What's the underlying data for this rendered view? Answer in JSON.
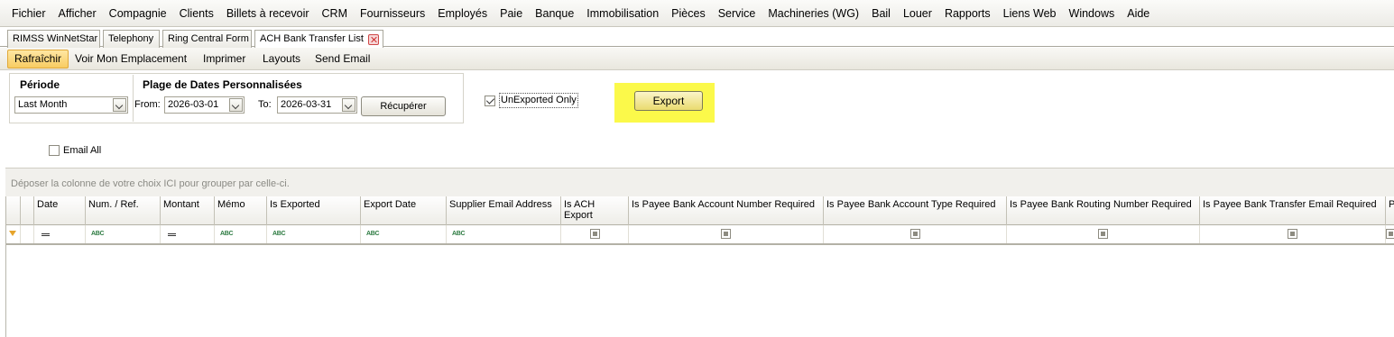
{
  "menu": [
    "Fichier",
    "Afficher",
    "Compagnie",
    "Clients",
    "Billets à recevoir",
    "CRM",
    "Fournisseurs",
    "Employés",
    "Paie",
    "Banque",
    "Immobilisation",
    "Pièces",
    "Service",
    "Machineries (WG)",
    "Bail",
    "Louer",
    "Rapports",
    "Liens Web",
    "Windows",
    "Aide"
  ],
  "tabs": [
    "RIMSS WinNetStar",
    "Telephony",
    "Ring Central Form",
    "ACH Bank Transfer List"
  ],
  "toolbar": {
    "refresh": "Rafraîchir",
    "view_location": "Voir Mon Emplacement",
    "print": "Imprimer",
    "layouts": "Layouts",
    "send_email": "Send Email"
  },
  "filters": {
    "period_title": "Période",
    "period_value": "Last Month",
    "range_title": "Plage de Dates Personnalisées",
    "from_label": "From:",
    "from_value": "2026-03-01",
    "to_label": "To:",
    "to_value": "2026-03-31",
    "retrieve_label": "Récupérer",
    "unexported_label": "UnExported Only",
    "unexported_checked": true,
    "export_label": "Export",
    "email_all_label": "Email All",
    "email_all_checked": false
  },
  "grid": {
    "group_hint": "Déposer la colonne de votre choix ICI pour grouper par celle-ci.",
    "columns": [
      {
        "label": "Date",
        "filter": "eq"
      },
      {
        "label": "Num. / Ref.",
        "filter": "abc"
      },
      {
        "label": "Montant",
        "filter": "eq"
      },
      {
        "label": "Mémo",
        "filter": "abc"
      },
      {
        "label": "Is Exported",
        "filter": "abc"
      },
      {
        "label": "Export Date",
        "filter": "abc"
      },
      {
        "label": "Supplier Email Address",
        "filter": "abc"
      },
      {
        "label": "Is ACH Export",
        "filter": "chk"
      },
      {
        "label": "Is Payee Bank Account Number Required",
        "filter": "chk"
      },
      {
        "label": "Is Payee Bank Account Type Required",
        "filter": "chk"
      },
      {
        "label": "Is Payee Bank Routing Number Required",
        "filter": "chk"
      },
      {
        "label": "Is Payee Bank Transfer Email Required",
        "filter": "chk"
      },
      {
        "label": "P",
        "filter": "chk"
      }
    ],
    "abc_glyph": "ABC"
  },
  "colors": {
    "highlight": "#fbf94a",
    "active_toolbar": "#f8cc62"
  }
}
